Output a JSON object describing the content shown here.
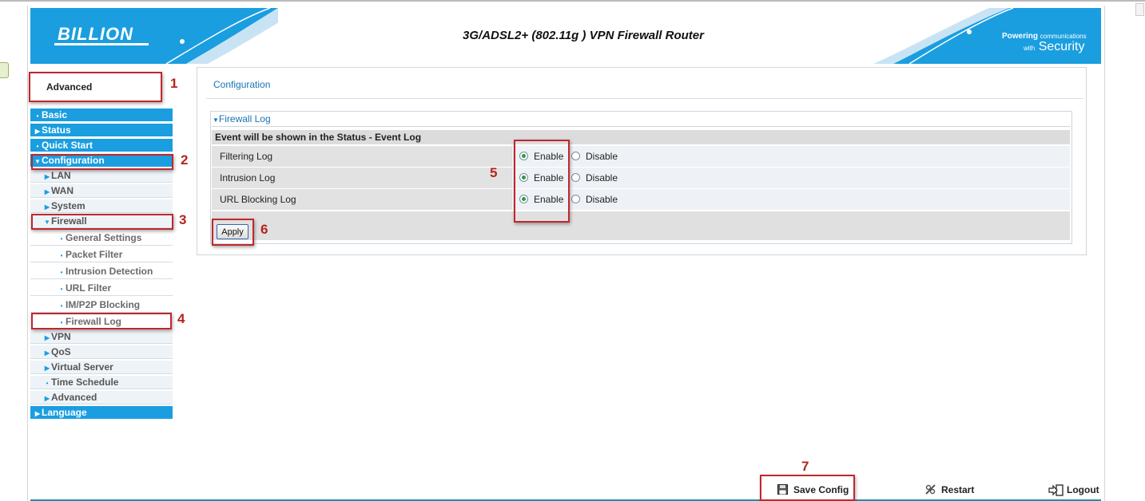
{
  "header": {
    "logo": "BILLION",
    "title": "3G/ADSL2+ (802.11g ) VPN Firewall Router",
    "tagline_1": "Powering",
    "tagline_1_small": "communications",
    "tagline_2_small": "with",
    "tagline_2": "Security",
    "colors": {
      "brand_blue": "#1a9ee0",
      "annotation_red": "#c0272d"
    }
  },
  "sidebar": {
    "mode_label": "Advanced",
    "items": [
      {
        "label": "Basic",
        "level": 0,
        "marker": "bullet"
      },
      {
        "label": "Status",
        "level": 0,
        "marker": "arrow-right"
      },
      {
        "label": "Quick Start",
        "level": 0,
        "marker": "bullet"
      },
      {
        "label": "Configuration",
        "level": 0,
        "marker": "arrow-down"
      },
      {
        "label": "LAN",
        "level": 1,
        "marker": "arrow-right"
      },
      {
        "label": "WAN",
        "level": 1,
        "marker": "arrow-right"
      },
      {
        "label": "System",
        "level": 1,
        "marker": "arrow-right"
      },
      {
        "label": "Firewall",
        "level": 1,
        "marker": "arrow-down"
      },
      {
        "label": "General Settings",
        "level": 2,
        "marker": "bullet"
      },
      {
        "label": "Packet Filter",
        "level": 2,
        "marker": "bullet"
      },
      {
        "label": "Intrusion Detection",
        "level": 2,
        "marker": "bullet"
      },
      {
        "label": "URL Filter",
        "level": 2,
        "marker": "bullet"
      },
      {
        "label": "IM/P2P Blocking",
        "level": 2,
        "marker": "bullet"
      },
      {
        "label": "Firewall Log",
        "level": 2,
        "marker": "bullet"
      },
      {
        "label": "VPN",
        "level": 1,
        "marker": "arrow-right"
      },
      {
        "label": "QoS",
        "level": 1,
        "marker": "arrow-right"
      },
      {
        "label": "Virtual Server",
        "level": 1,
        "marker": "arrow-right"
      },
      {
        "label": "Time Schedule",
        "level": 1,
        "marker": "bullet"
      },
      {
        "label": "Advanced",
        "level": 1,
        "marker": "arrow-right"
      },
      {
        "label": "Language",
        "level": 0,
        "marker": "arrow-right"
      }
    ]
  },
  "main": {
    "panel_title": "Configuration",
    "section_title": "Firewall Log",
    "event_note": "Event will be shown in the Status - Event Log",
    "rows": [
      {
        "label": "Filtering Log",
        "enable": "Enable",
        "disable": "Disable",
        "selected": "Enable"
      },
      {
        "label": "Intrusion Log",
        "enable": "Enable",
        "disable": "Disable",
        "selected": "Enable"
      },
      {
        "label": "URL Blocking Log",
        "enable": "Enable",
        "disable": "Disable",
        "selected": "Enable"
      }
    ],
    "apply_label": "Apply"
  },
  "footer": {
    "save": "Save Config",
    "restart": "Restart",
    "logout": "Logout"
  },
  "annotations": [
    "1",
    "2",
    "3",
    "4",
    "5",
    "6",
    "7"
  ]
}
